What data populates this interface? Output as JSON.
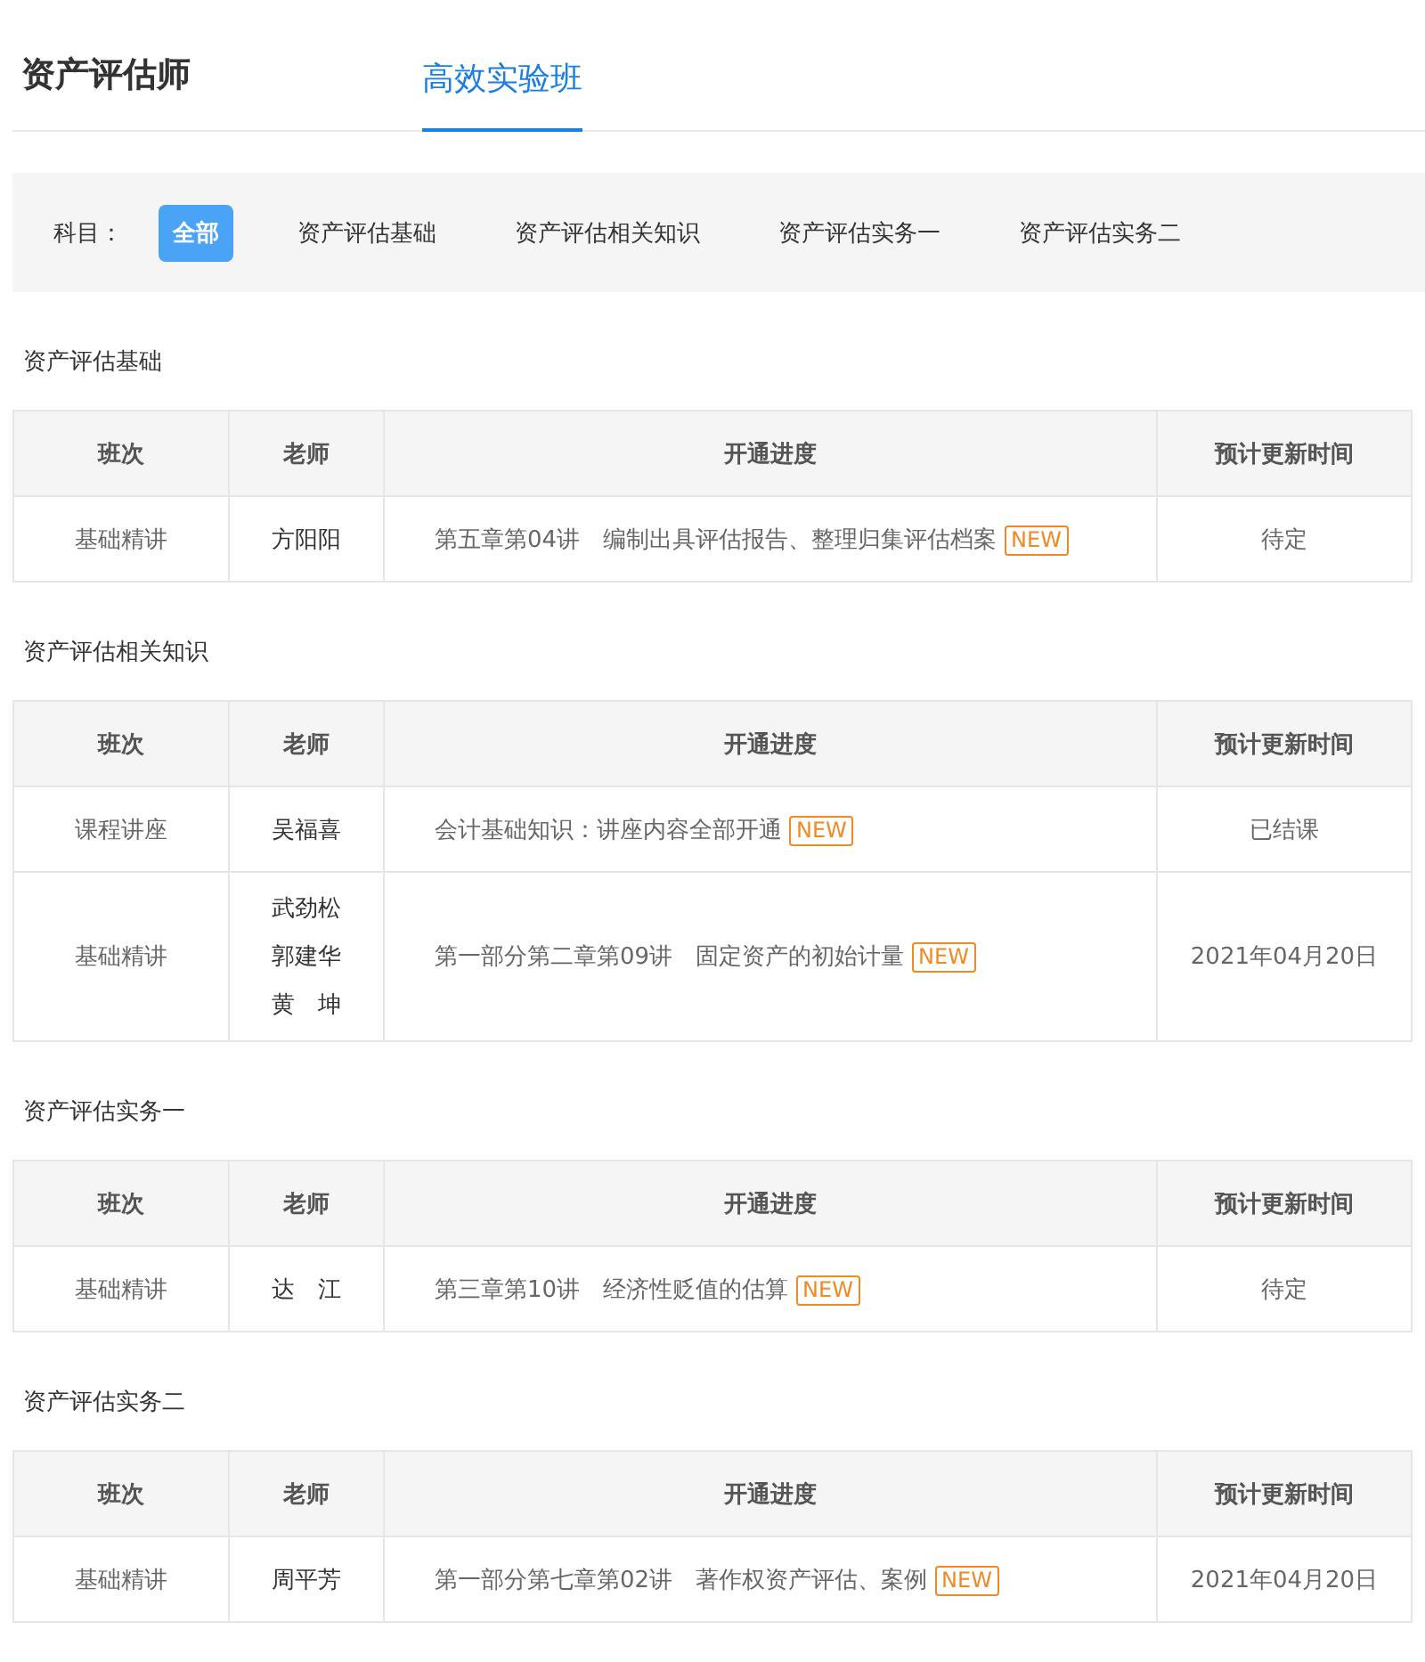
{
  "header": {
    "title": "资产评估师",
    "tabs": [
      {
        "label": "高效实验班",
        "selected": true
      }
    ]
  },
  "filter": {
    "label": "科目：",
    "options": [
      {
        "label": "全部",
        "selected": true
      },
      {
        "label": "资产评估基础",
        "selected": false
      },
      {
        "label": "资产评估相关知识",
        "selected": false
      },
      {
        "label": "资产评估实务一",
        "selected": false
      },
      {
        "label": "资产评估实务二",
        "selected": false
      }
    ]
  },
  "sections": [
    {
      "title": "资产评估基础",
      "columns": [
        "班次",
        "老师",
        "开通进度",
        "预计更新时间"
      ],
      "rows": [
        {
          "class": "基础精讲",
          "teachers": [
            "方阳阳"
          ],
          "progress": "第五章第04讲　编制出具评估报告、整理归集评估档案",
          "badge": "NEW",
          "update": "待定"
        }
      ]
    },
    {
      "title": "资产评估相关知识",
      "columns": [
        "班次",
        "老师",
        "开通进度",
        "预计更新时间"
      ],
      "rows": [
        {
          "class": "课程讲座",
          "teachers": [
            "吴福喜"
          ],
          "progress": "会计基础知识：讲座内容全部开通",
          "badge": "NEW",
          "update": "已结课"
        },
        {
          "class": "基础精讲",
          "teachers": [
            "武劲松",
            "郭建华",
            "黄　坤"
          ],
          "progress": "第一部分第二章第09讲　固定资产的初始计量",
          "badge": "NEW",
          "update": "2021年04月20日"
        }
      ]
    },
    {
      "title": "资产评估实务一",
      "columns": [
        "班次",
        "老师",
        "开通进度",
        "预计更新时间"
      ],
      "rows": [
        {
          "class": "基础精讲",
          "teachers": [
            "达　江"
          ],
          "progress": "第三章第10讲　经济性贬值的估算",
          "badge": "NEW",
          "update": "待定"
        }
      ]
    },
    {
      "title": "资产评估实务二",
      "columns": [
        "班次",
        "老师",
        "开通进度",
        "预计更新时间"
      ],
      "rows": [
        {
          "class": "基础精讲",
          "teachers": [
            "周平芳"
          ],
          "progress": "第一部分第七章第02讲　著作权资产评估、案例",
          "badge": "NEW",
          "update": "2021年04月20日"
        }
      ]
    }
  ]
}
